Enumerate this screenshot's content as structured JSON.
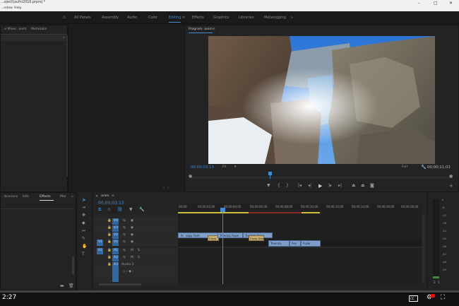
{
  "window": {
    "title": "...oject\\\\sufni2016.prproj *",
    "menu": [
      "...ndow",
      "Help"
    ],
    "controls": [
      "–",
      "□",
      "✕"
    ]
  },
  "workspaces": {
    "items": [
      "All Panels",
      "Assembly",
      "Audio",
      "Color",
      "Editing",
      "Effects",
      "Graphics",
      "Libraries",
      "Metalogging"
    ],
    "active": "Editing",
    "menu_icon": "≡",
    "more": "»"
  },
  "source_panel": {
    "tabs": [
      "...e Mixer: anim",
      "Metadata"
    ],
    "more": "»"
  },
  "program_monitor": {
    "title": "Program: anim",
    "menu_icon": "≡",
    "timecode_current": "00;00;03;13",
    "fit": "Fit",
    "fit_arrow": "▾",
    "zoom": "Full",
    "timecode_total": "00;00;11;01"
  },
  "effects_panel": {
    "tabs": [
      "...brorians",
      "Info",
      "Effects",
      "Mar"
    ],
    "active": "Effects",
    "more": "»"
  },
  "timeline": {
    "sequence": "anim",
    "timecode": "00;00;03;13",
    "ruler": [
      "00;00",
      "00;00;02;00",
      "00;00;04;00",
      "00;00;06;00",
      "00;00;08;00",
      "00;00;10;00",
      "00;00;12;00",
      "00;00;14;00",
      "00;00;16;00",
      "00;00;18;00"
    ],
    "tracks": [
      {
        "id": "V4",
        "src": ""
      },
      {
        "id": "V3",
        "src": ""
      },
      {
        "id": "V2",
        "src": ""
      },
      {
        "id": "V1",
        "src": "V1"
      },
      {
        "id": "A1",
        "src": "A1",
        "lock": "B",
        "m": "M",
        "s": "S"
      },
      {
        "id": "A2",
        "src": "",
        "m": "M",
        "s": "S"
      },
      {
        "id": "A3",
        "src": "",
        "name": "Audio 2"
      }
    ],
    "clips": {
      "c1": "sapy Fash",
      "c1b": "Cross",
      "c2": "Trvenza Fowe",
      "c3": "Trvenza Fowe",
      "c3b": "Cross Dissol",
      "c4": "Trvenza",
      "c5": "Fen",
      "c6": "Fuzer"
    },
    "fx": "fx"
  },
  "meter": {
    "scale": [
      "0",
      "-6",
      "-12",
      "-18",
      "-24",
      "-30",
      "-36",
      "-42",
      "-48",
      "-54"
    ],
    "sr": [
      "S",
      "S"
    ]
  },
  "youtube": {
    "time": "2:27",
    "cc": "CC"
  },
  "colors": {
    "accent": "#3e8fd8",
    "clip_video": "#7f9fc9",
    "clip_transition": "#c7ad73",
    "render_yellow": "#c8c03a",
    "render_red": "#8e2727",
    "youtube_red": "#ff0000"
  }
}
